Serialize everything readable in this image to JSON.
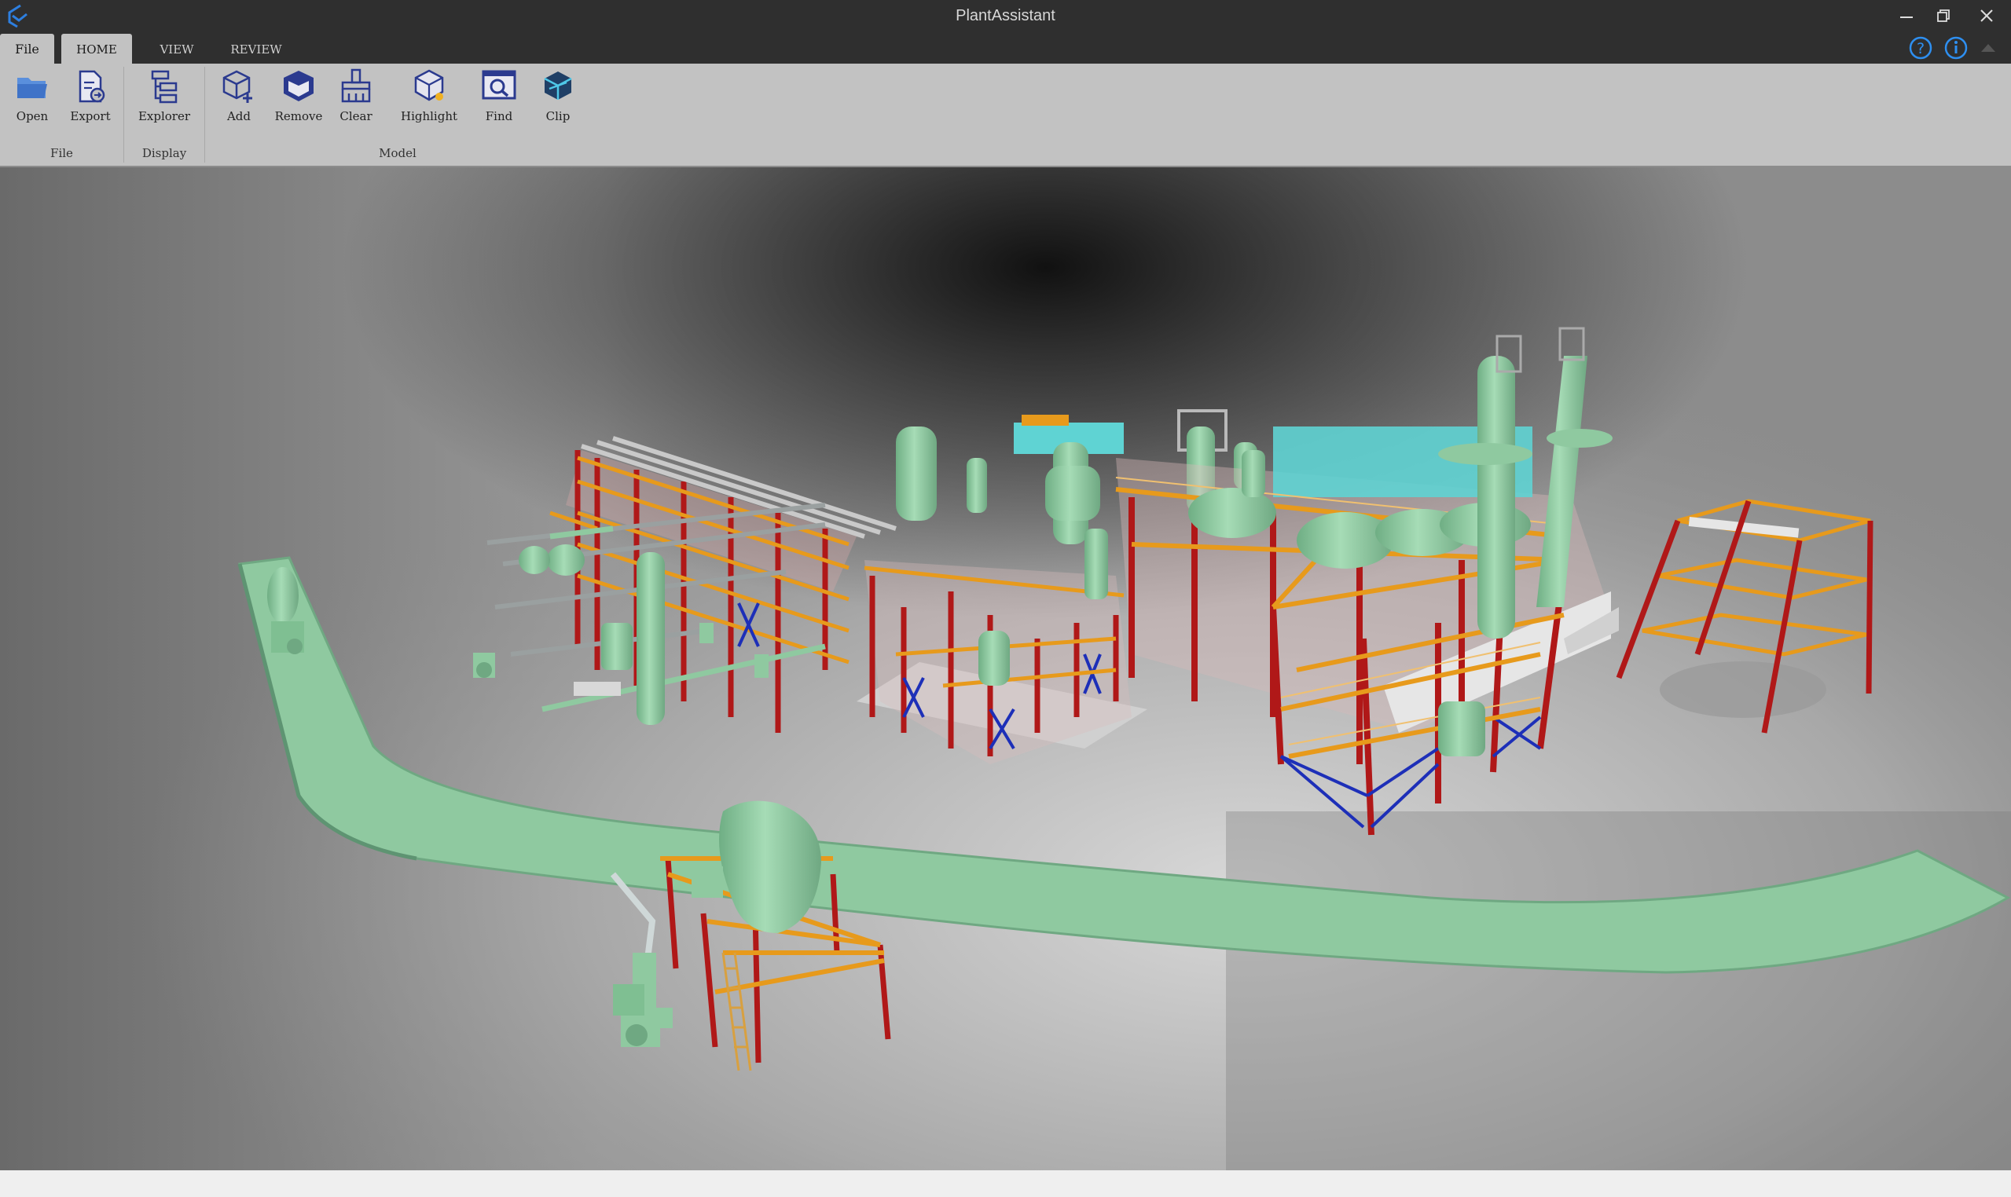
{
  "window": {
    "title": "PlantAssistant",
    "logo_icon": "app-logo-icon",
    "controls": [
      "minimize-icon",
      "restore-icon",
      "close-icon"
    ]
  },
  "tabs": {
    "file": "File",
    "home": "HOME",
    "view": "VIEW",
    "review": "REVIEW",
    "active": "HOME"
  },
  "help_icons": [
    "help-icon",
    "info-icon",
    "collapse-ribbon-icon"
  ],
  "ribbon": {
    "groups": {
      "file": "File",
      "display": "Display",
      "model": "Model"
    },
    "buttons": {
      "open": "Open",
      "export": "Export",
      "explorer": "Explorer",
      "add": "Add",
      "remove": "Remove",
      "clear": "Clear",
      "highlight": "Highlight",
      "find": "Find",
      "clip": "Clip"
    }
  },
  "colors": {
    "titlebar": "#2f2f2f",
    "ribbon": "#c2c2c2",
    "icon_blue": "#2b3a8f",
    "equipment_green": "#8fc9a0",
    "steel_red": "#b01818",
    "platform_orange": "#e79a1c",
    "bracing_blue": "#1d2fb8",
    "duct_cyan": "#5fd3d3"
  }
}
